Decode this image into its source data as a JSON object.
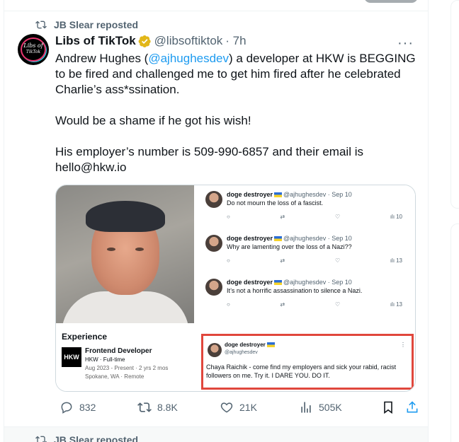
{
  "repost": {
    "label": "JB Slear reposted"
  },
  "post": {
    "author_name": "Libs of TikTok",
    "avatar_line1": "Libs of",
    "avatar_line2": "TikTok",
    "handle": "@libsoftiktok",
    "time": "· 7h",
    "more": "···",
    "text": {
      "l1_a": "Andrew Hughes (",
      "l1_mention": "@ajhughesdev",
      "l1_b": ") a developer at HKW is BEGGING to be fired and challenged me to get him fired after he celebrated Charlie’s ass*ssination.",
      "p2": "Would be a shame if he got his wish!",
      "p3": "His employer’s number is 509-990-6857 and their email is hello@hkw.io"
    },
    "media": {
      "replies": [
        {
          "name": "doge destroyer",
          "meta": "@ajhughesdev · Sep 10",
          "text": "Do not mourn the loss of a fascist.",
          "views": "10"
        },
        {
          "name": "doge destroyer",
          "meta": "@ajhughesdev · Sep 10",
          "text": "Why are lamenting over the loss of a Nazi??",
          "views": "13"
        },
        {
          "name": "doge destroyer",
          "meta": "@ajhughesdev · Sep 10",
          "text": "It’s not a horrific assassination to silence a Nazi.",
          "views": "13"
        }
      ],
      "experience": {
        "title": "Experience",
        "logo": "HKW",
        "job_title": "Frontend Developer",
        "company": "HKW · Full-time",
        "dates": "Aug 2023 - Present · 2 yrs 2 mos",
        "location": "Spokane, WA · Remote"
      },
      "highlight": {
        "name": "doge destroyer",
        "handle": "@ajhughesdev",
        "text": "Chaya Raichik - come find my employers and sick your rabid, racist followers on me. Try it. I DARE YOU. DO IT."
      }
    },
    "metrics": {
      "replies": "832",
      "reposts": "8.8K",
      "likes": "21K",
      "views": "505K"
    }
  },
  "next_repost": {
    "label": "JB Slear reposted"
  },
  "colors": {
    "accent": "#1d9bf0",
    "muted": "#536471",
    "highlight_border": "#e0473c"
  }
}
